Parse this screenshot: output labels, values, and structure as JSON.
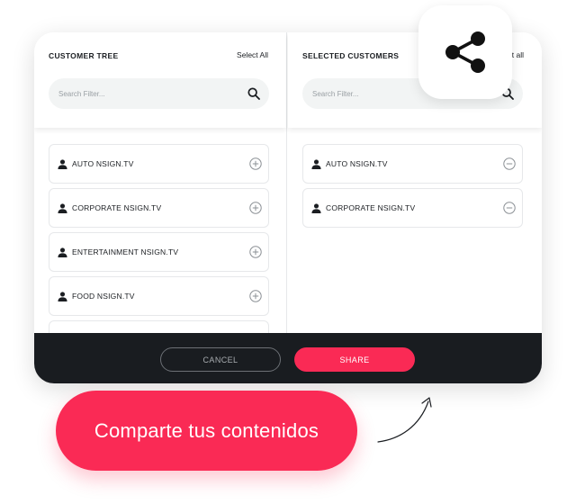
{
  "left_panel": {
    "title": "CUSTOMER TREE",
    "select_all": "Select All",
    "search_placeholder": "Search Filter...",
    "items": [
      {
        "label": "AUTO NSIGN.TV"
      },
      {
        "label": "CORPORATE NSIGN.TV"
      },
      {
        "label": "ENTERTAINMENT NSIGN.TV"
      },
      {
        "label": "FOOD NSIGN.TV"
      }
    ]
  },
  "right_panel": {
    "title": "SELECTED CUSTOMERS",
    "select_all": "Select all",
    "search_placeholder": "Search Filter...",
    "items": [
      {
        "label": "AUTO NSIGN.TV"
      },
      {
        "label": "CORPORATE NSIGN.TV"
      }
    ]
  },
  "footer": {
    "cancel_label": "CANCEL",
    "share_label": "SHARE"
  },
  "cta": {
    "text": "Comparte tus contenidos"
  },
  "icons": {
    "share_badge": "share-icon",
    "search": "search-icon",
    "user": "user-icon",
    "add": "plus-circle-icon",
    "remove": "minus-circle-icon"
  },
  "colors": {
    "accent": "#fa2a55",
    "footer_bg": "#191c20",
    "text": "#1b1e22"
  }
}
